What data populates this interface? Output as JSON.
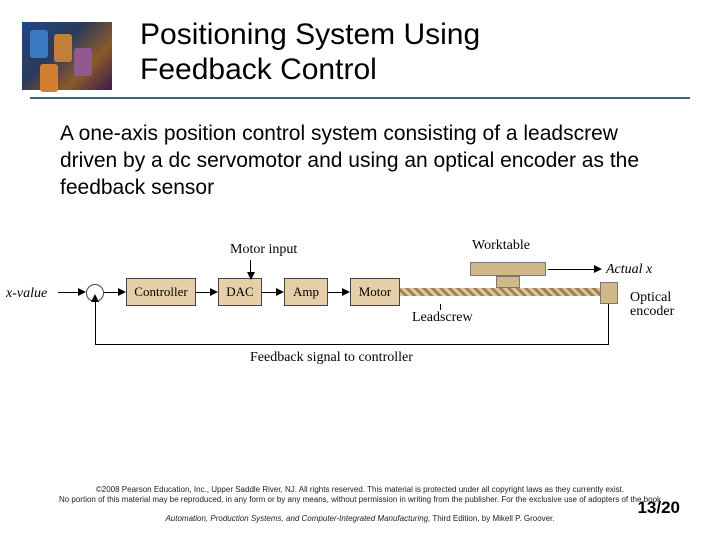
{
  "header": {
    "title_line1": "Positioning System Using",
    "title_line2": "Feedback Control"
  },
  "body": {
    "paragraph": "A one-axis position control system consisting of a leadscrew driven by a dc servomotor and using an optical encoder as the feedback sensor"
  },
  "diagram": {
    "x_value": "x-value",
    "controller": "Controller",
    "dac": "DAC",
    "motor_input": "Motor input",
    "amp": "Amp",
    "motor": "Motor",
    "leadscrew": "Leadscrew",
    "feedback": "Feedback signal to controller",
    "worktable": "Worktable",
    "actual_x": "Actual x",
    "optical_encoder_1": "Optical",
    "optical_encoder_2": "encoder"
  },
  "footer": {
    "copyright": "©2008 Pearson Education, Inc., Upper Saddle River, NJ. All rights reserved. This material is protected under all copyright laws as they currently exist.",
    "restriction": "No portion of this material may be reproduced, in any form or by any means, without permission in writing from the publisher. For the exclusive use of adopters of the book",
    "book": "Automation, Production Systems, and Computer-Integrated Manufacturing,",
    "edition": " Third Edition, by Mikell P. Groover."
  },
  "page": {
    "number": "13/20"
  }
}
